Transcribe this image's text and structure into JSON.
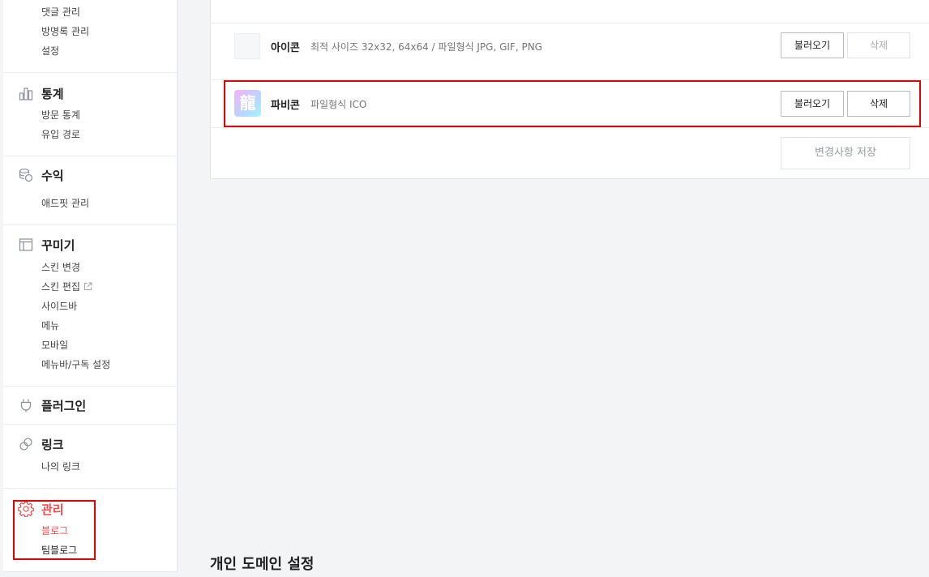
{
  "sidebar": {
    "top_items": [
      "댓글 관리",
      "방명록 관리",
      "설정"
    ],
    "stats": {
      "title": "통계",
      "items": [
        "방문 통계",
        "유입 경로"
      ]
    },
    "revenue": {
      "title": "수익",
      "items": [
        "애드핏 관리"
      ]
    },
    "decorate": {
      "title": "꾸미기",
      "items": [
        "스킨 변경",
        "스킨 편집",
        "사이드바",
        "메뉴",
        "모바일",
        "메뉴바/구독 설정"
      ]
    },
    "plugin": {
      "title": "플러그인"
    },
    "link": {
      "title": "링크",
      "items": [
        "나의 링크"
      ]
    },
    "manage": {
      "title": "관리",
      "items": [
        "블로그",
        "팀블로그"
      ]
    }
  },
  "panel": {
    "icon_row": {
      "title": "아이콘",
      "desc": "최적 사이즈 32x32, 64x64 / 파일형식 JPG, GIF, PNG",
      "load_label": "불러오기",
      "delete_label": "삭제"
    },
    "favicon_row": {
      "title": "파비콘",
      "desc": "파일형식 ICO",
      "glyph": "龍",
      "load_label": "불러오기",
      "delete_label": "삭제"
    },
    "save_label": "변경사항 저장"
  },
  "section": {
    "domain_title": "개인 도메인 설정"
  },
  "colors": {
    "accent": "#ef4a4a",
    "highlight_box": "#e50000"
  }
}
